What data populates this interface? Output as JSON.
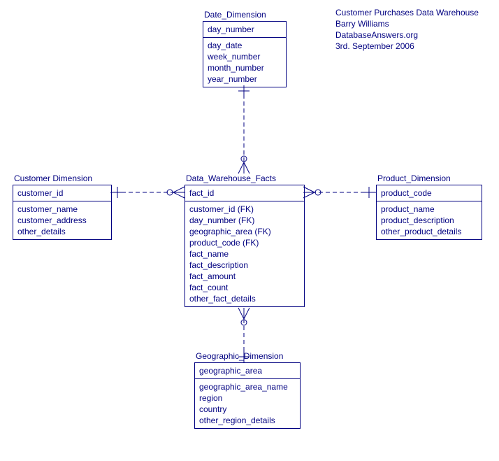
{
  "meta": {
    "line1": "Customer Purchases Data Warehouse",
    "line2": "Barry Williams",
    "line3": "DatabaseAnswers.org",
    "line4": "3rd. September 2006"
  },
  "entities": {
    "date_dimension": {
      "title": "Date_Dimension",
      "pk": [
        "day_number"
      ],
      "attrs": [
        "day_date",
        "week_number",
        "month_number",
        "year_number"
      ]
    },
    "customer_dimension": {
      "title": "Customer Dimension",
      "pk": [
        "customer_id"
      ],
      "attrs": [
        "customer_name",
        "customer_address",
        "other_details"
      ]
    },
    "fact": {
      "title": "Data_Warehouse_Facts",
      "pk": [
        "fact_id"
      ],
      "attrs": [
        "customer_id (FK)",
        "day_number (FK)",
        "geographic_area (FK)",
        "product_code (FK)",
        "fact_name",
        "fact_description",
        "fact_amount",
        "fact_count",
        "other_fact_details"
      ]
    },
    "product_dimension": {
      "title": "Product_Dimension",
      "pk": [
        "product_code"
      ],
      "attrs": [
        "product_name",
        "product_description",
        "other_product_details"
      ]
    },
    "geographic_dimension": {
      "title": "Geographic_Dimension",
      "pk": [
        "geographic_area"
      ],
      "attrs": [
        "geographic_area_name",
        "region",
        "country",
        "other_region_details"
      ]
    }
  }
}
